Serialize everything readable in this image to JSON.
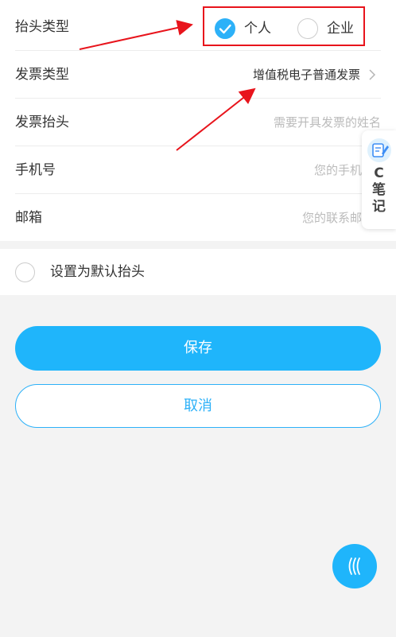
{
  "form": {
    "header_type": {
      "label": "抬头类型",
      "options": [
        {
          "label": "个人",
          "checked": true
        },
        {
          "label": "企业",
          "checked": false
        }
      ]
    },
    "invoice_type": {
      "label": "发票类型",
      "value": "增值税电子普通发票"
    },
    "invoice_header": {
      "label": "发票抬头",
      "placeholder": "需要开具发票的姓名"
    },
    "phone": {
      "label": "手机号",
      "placeholder": "您的手机"
    },
    "email": {
      "label": "邮箱",
      "placeholder": "您的联系邮"
    }
  },
  "default_header": {
    "label": "设置为默认抬头",
    "checked": false
  },
  "buttons": {
    "save": "保存",
    "cancel": "取消"
  },
  "note_widget": {
    "icon": "note-pen-icon",
    "label": "C笔记"
  },
  "float_button": {
    "icon": "wave-lines-icon"
  },
  "colors": {
    "accent": "#1fb5fb",
    "annotation": "#e8141c"
  }
}
